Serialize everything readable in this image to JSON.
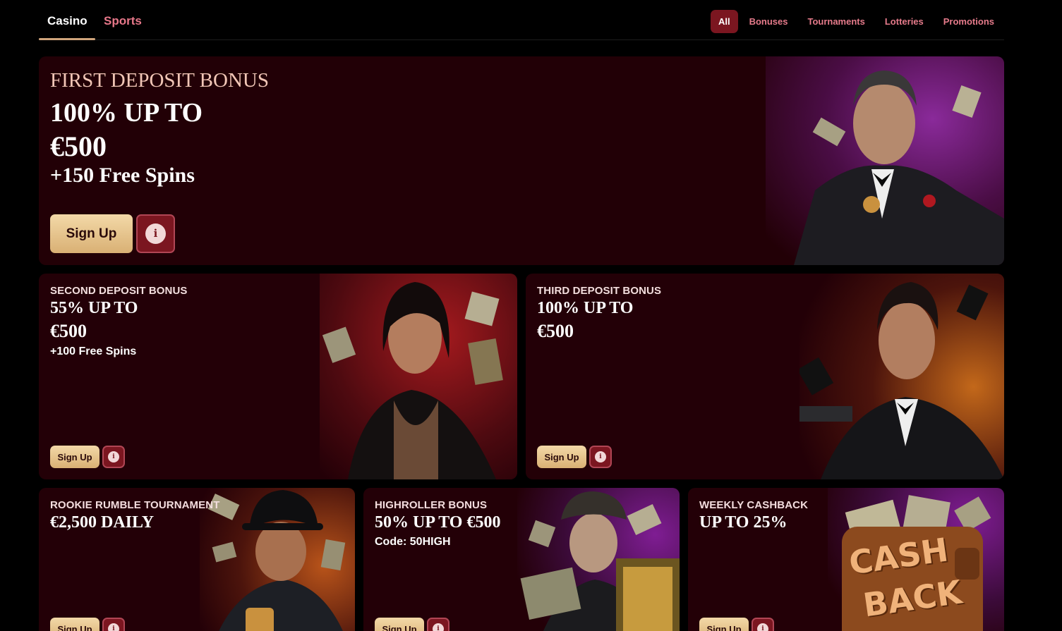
{
  "nav": {
    "tabs": [
      "Casino",
      "Sports"
    ],
    "filters": [
      "All",
      "Bonuses",
      "Tournaments",
      "Lotteries",
      "Promotions"
    ]
  },
  "cards": {
    "first": {
      "title": "FIRST DEPOSIT BONUS",
      "line1": "100% UP TO",
      "line2": "€500",
      "line3": "+150 Free Spins",
      "signup": "Sign Up",
      "info_icon": "info-icon"
    },
    "second": {
      "title": "SECOND DEPOSIT BONUS",
      "line1": "55% UP TO",
      "line2": "€500",
      "sub": "+100 Free Spins",
      "signup": "Sign Up"
    },
    "third": {
      "title": "THIRD DEPOSIT BONUS",
      "line1": "100% UP TO",
      "line2": "€500",
      "signup": "Sign Up"
    },
    "rookie": {
      "title": "ROOKIE RUMBLE TOURNAMENT",
      "line1": "€2,500 DAILY",
      "signup": "Sign Up"
    },
    "highroller": {
      "title": "HIGHROLLER BONUS",
      "line1": "50% UP TO €500",
      "sub": "Code: 50HIGH",
      "signup": "Sign Up"
    },
    "cashback": {
      "title": "WEEKLY CASHBACK",
      "line1": "UP TO 25%",
      "signup": "Sign Up",
      "art_text_1": "CASH",
      "art_text_2": "BACK"
    }
  },
  "colors": {
    "accent": "#7b1620",
    "card_bg": "#230007",
    "gold": "#e8c48c",
    "pink_text": "#e67b8b"
  }
}
